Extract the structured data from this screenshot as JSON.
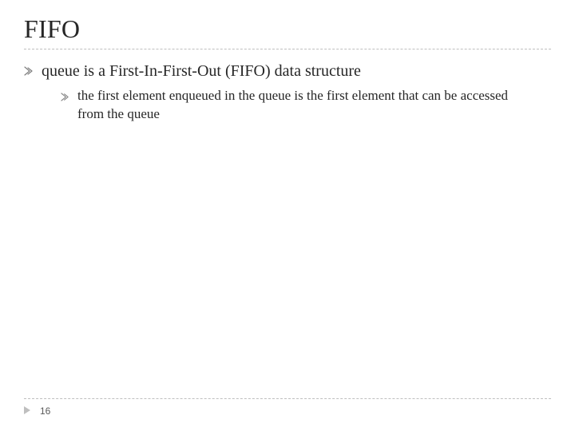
{
  "slide": {
    "title": "FIFO",
    "bullets": [
      {
        "text": "queue is a First-In-First-Out (FIFO) data structure",
        "children": [
          {
            "text": "the first element enqueued in the queue is the first element that can be accessed from the queue"
          }
        ]
      }
    ],
    "page_number": "16"
  },
  "icons": {
    "bullet_glyph": "arrow-tri",
    "footer_arrow": "play-tri"
  }
}
